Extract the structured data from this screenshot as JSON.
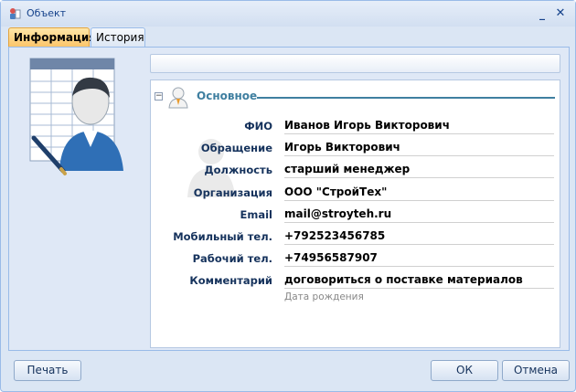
{
  "window": {
    "title": "Объект"
  },
  "tabs": [
    {
      "label": "Информация",
      "active": true
    },
    {
      "label": "История",
      "active": false
    }
  ],
  "section": {
    "title": "Основное",
    "collapse_symbol": "−"
  },
  "fields": [
    {
      "label": "ФИО",
      "value": "Иванов Игорь Викторович"
    },
    {
      "label": "Обращение",
      "value": "Игорь Викторович"
    },
    {
      "label": "Должность",
      "value": "старший менеджер"
    },
    {
      "label": "Организация",
      "value": "ООО \"СтройТех\""
    },
    {
      "label": "Email",
      "value": "mail@stroyteh.ru"
    },
    {
      "label": "Мобильный тел.",
      "value": "+792523456785"
    },
    {
      "label": "Рабочий тел.",
      "value": "+74956587907"
    },
    {
      "label": "Комментарий",
      "value": "договориться о поставке материалов"
    }
  ],
  "empty_field_hint": "Дата рождения",
  "buttons": {
    "print": "Печать",
    "ok": "ОК",
    "cancel": "Отмена"
  },
  "colors": {
    "accent": "#3f7fa0",
    "frame": "#99bbe8",
    "active_tab": "#fbc56a"
  },
  "icons": {
    "app": "contact-book-icon",
    "minimize": "minimize-icon",
    "close": "close-icon",
    "person": "person-icon"
  }
}
